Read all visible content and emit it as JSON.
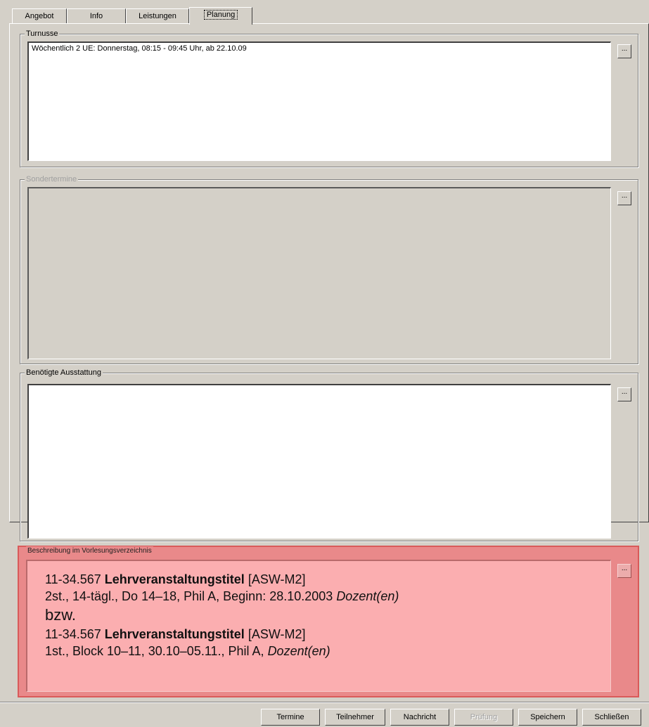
{
  "tabs": [
    {
      "label": "Angebot"
    },
    {
      "label": "Info"
    },
    {
      "label": "Leistungen"
    },
    {
      "label": "Planung",
      "active": true
    }
  ],
  "turnusse": {
    "label": "Turnusse",
    "value": "Wöchentlich 2 UE: Donnerstag, 08:15 - 09:45 Uhr, ab 22.10.09",
    "button_label": "..."
  },
  "sondertermine": {
    "label": "Sondertermine",
    "value": "",
    "button_label": "..."
  },
  "ausstattung": {
    "label": "Benötigte Ausstattung",
    "value": "",
    "button_label": "..."
  },
  "beschreibung": {
    "label": "Beschreibung im Vorlesungsverzeichnis",
    "button_label": "...",
    "line1_number": "11-34.567",
    "line1_title": "Lehrveranstaltungstitel",
    "line1_code": "[ASW-M2]",
    "line2_text": "2st., 14-tägl., Do 14–18, Phil A, Beginn: 28.10.2003",
    "line2_lecturer": "Dozent(en)",
    "connector": "bzw.",
    "line3_number": "11-34.567",
    "line3_title": "Lehrveranstaltungstitel",
    "line3_code": "[ASW-M2]",
    "line4_text": "1st., Block 10–11, 30.10–05.11., Phil A,",
    "line4_lecturer": "Dozent(en)",
    "highlight_color": "#e9898a"
  },
  "buttons": {
    "termine": "Termine",
    "teilnehmer": "Teilnehmer",
    "nachricht": "Nachricht",
    "pruefung": "Prüfung",
    "speichern": "Speichern",
    "schliessen": "Schließen"
  }
}
